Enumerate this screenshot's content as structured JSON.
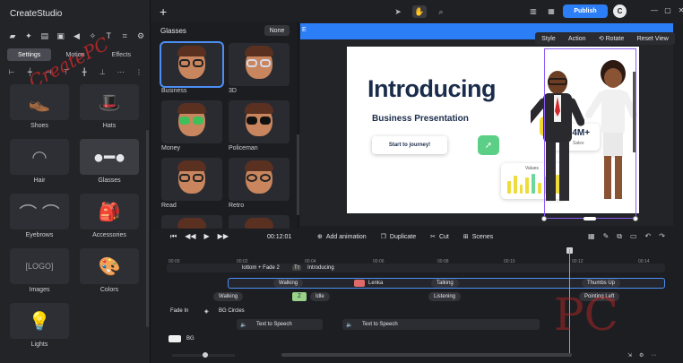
{
  "app": {
    "title": "CreateStudio"
  },
  "sidebar": {
    "tabs": [
      {
        "label": "Settings",
        "active": true
      },
      {
        "label": "Motion",
        "active": false
      },
      {
        "label": "Effects",
        "active": false
      }
    ],
    "categories": [
      {
        "label": "Shoes",
        "icon": "shoe-icon"
      },
      {
        "label": "Hats",
        "icon": "hat-icon"
      },
      {
        "label": "Hair",
        "icon": "hair-icon"
      },
      {
        "label": "Glasses",
        "icon": "glasses-icon",
        "selected": true
      },
      {
        "label": "Eyebrows",
        "icon": "eyebrows-icon"
      },
      {
        "label": "Accessories",
        "icon": "backpack-icon"
      },
      {
        "label": "Images",
        "icon": "logo-image-icon",
        "thumb_text": "[LOGO]"
      },
      {
        "label": "Colors",
        "icon": "palette-icon"
      },
      {
        "label": "Lights",
        "icon": "bulb-icon"
      }
    ]
  },
  "glasses_panel": {
    "title": "Glasses",
    "none_label": "None",
    "items": [
      {
        "label": "Business",
        "selected": true,
        "lens_color": "#1c1c1c"
      },
      {
        "label": "3D",
        "lens_color": "#d9d9e6"
      },
      {
        "label": "Money",
        "lens_color": "#3fbf5a"
      },
      {
        "label": "Policeman",
        "lens_color": "#111111"
      },
      {
        "label": "Read",
        "lens_color": "#1c1c1c"
      },
      {
        "label": "Retro",
        "lens_color": "#1c1c1c"
      }
    ]
  },
  "topbar": {
    "publish_label": "Publish",
    "logo_letter": "C"
  },
  "context_menu": {
    "items": [
      "Style",
      "Action",
      "Rotate",
      "Reset View"
    ]
  },
  "slide": {
    "title": "Introducing",
    "subtitle": "Business Presentation",
    "cta": "Start to journey!",
    "stat_value": "5.4M+",
    "stat_label": "Sales",
    "values_label": "Values",
    "values_bars": [
      14,
      20,
      10,
      18,
      22,
      12,
      19,
      16,
      21
    ]
  },
  "timeline": {
    "timecode": "00:12:01",
    "actions": [
      {
        "label": "Add animation",
        "icon": "add-animation-icon"
      },
      {
        "label": "Duplicate",
        "icon": "duplicate-icon"
      },
      {
        "label": "Cut",
        "icon": "scissors-icon"
      },
      {
        "label": "Scenes",
        "icon": "scenes-icon"
      }
    ],
    "ruler": [
      "00:00",
      "00:02",
      "00:04",
      "00:06",
      "00:08",
      "00:10",
      "00:12",
      "00:14"
    ],
    "row1": {
      "left": "lottom + Fade 2",
      "text_label": "Introducing"
    },
    "row2": {
      "a": "Walking",
      "b": "Lenka",
      "c": "Talking",
      "d": "Thumbs Up"
    },
    "row3": {
      "a": "Walking",
      "b": "Idle",
      "c": "Listening",
      "d": "Pointing Left"
    },
    "row4": {
      "a": "Fade In",
      "b": "BG Circles"
    },
    "row5": {
      "a": "Text to Speech",
      "b": "Text to Speech"
    },
    "row6": {
      "a": "BG"
    }
  }
}
